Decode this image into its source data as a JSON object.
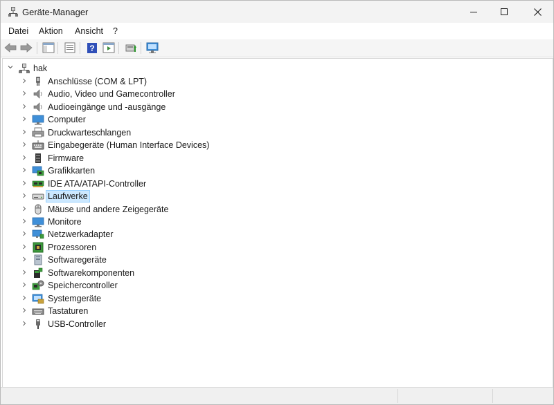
{
  "window": {
    "title": "Geräte-Manager",
    "accent": "#cce8ff"
  },
  "caption_buttons": [
    "minimize-icon",
    "maximize-icon",
    "close-icon"
  ],
  "menu": [
    "Datei",
    "Aktion",
    "Ansicht",
    "?"
  ],
  "toolbar": {
    "buttons": [
      "back-arrow-icon",
      "forward-arrow-icon",
      "show-hide-console-tree-icon",
      "properties-icon",
      "help-icon",
      "action-pane-icon",
      "update-driver-icon",
      "scan-hardware-icon"
    ]
  },
  "tree": {
    "root": {
      "label": "hak",
      "icon": "computer-network-icon"
    },
    "items": [
      {
        "label": "Anschlüsse (COM & LPT)",
        "icon": "port-icon"
      },
      {
        "label": "Audio, Video und Gamecontroller",
        "icon": "speaker-icon"
      },
      {
        "label": "Audioeingänge und -ausgänge",
        "icon": "speaker-icon"
      },
      {
        "label": "Computer",
        "icon": "monitor-icon"
      },
      {
        "label": "Druckwarteschlangen",
        "icon": "printer-icon"
      },
      {
        "label": "Eingabegeräte (Human Interface Devices)",
        "icon": "hid-icon"
      },
      {
        "label": "Firmware",
        "icon": "chip-icon"
      },
      {
        "label": "Grafikkarten",
        "icon": "display-adapter-icon"
      },
      {
        "label": "IDE ATA/ATAPI-Controller",
        "icon": "ide-controller-icon"
      },
      {
        "label": "Laufwerke",
        "icon": "disk-drive-icon",
        "selected": true
      },
      {
        "label": "Mäuse und andere Zeigegeräte",
        "icon": "mouse-icon"
      },
      {
        "label": "Monitore",
        "icon": "monitor-icon"
      },
      {
        "label": "Netzwerkadapter",
        "icon": "network-adapter-icon"
      },
      {
        "label": "Prozessoren",
        "icon": "processor-icon"
      },
      {
        "label": "Softwaregeräte",
        "icon": "software-device-icon"
      },
      {
        "label": "Softwarekomponenten",
        "icon": "software-component-icon"
      },
      {
        "label": "Speichercontroller",
        "icon": "storage-controller-icon"
      },
      {
        "label": "Systemgeräte",
        "icon": "system-device-icon"
      },
      {
        "label": "Tastaturen",
        "icon": "keyboard-icon"
      },
      {
        "label": "USB-Controller",
        "icon": "usb-icon"
      }
    ]
  }
}
